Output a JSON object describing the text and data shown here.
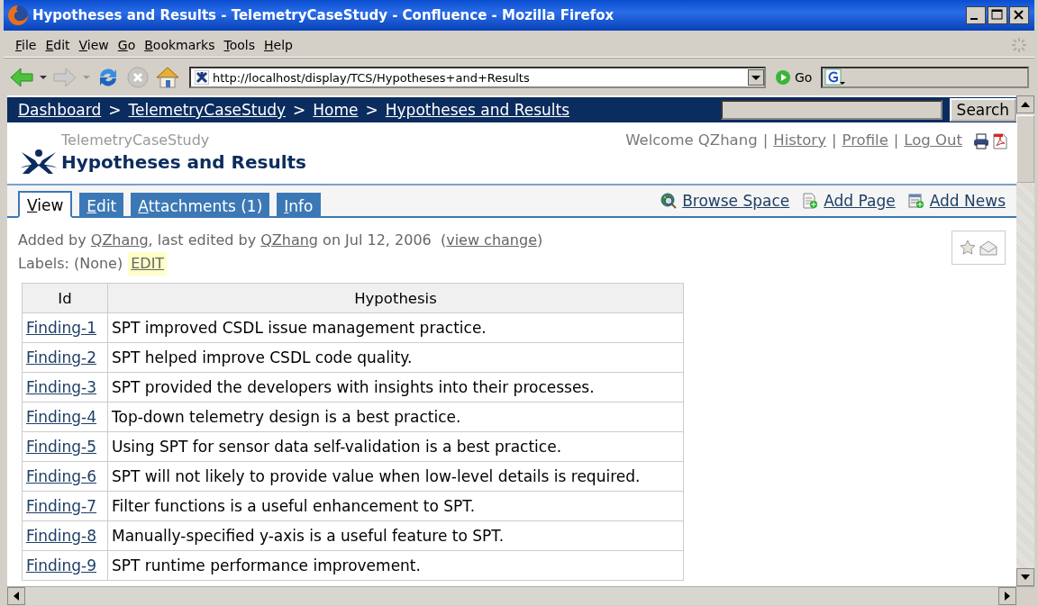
{
  "window": {
    "title": "Hypotheses and Results - TelemetryCaseStudy - Confluence - Mozilla Firefox"
  },
  "menu": [
    "File",
    "Edit",
    "View",
    "Go",
    "Bookmarks",
    "Tools",
    "Help"
  ],
  "address": {
    "url": "http://localhost/display/TCS/Hypotheses+and+Results",
    "go": "Go"
  },
  "breadcrumbs": {
    "separator": ">",
    "items": [
      "Dashboard",
      "TelemetryCaseStudy",
      "Home",
      "Hypotheses and Results"
    ]
  },
  "search": {
    "button": "Search"
  },
  "header": {
    "space": "TelemetryCaseStudy",
    "title": "Hypotheses and Results",
    "welcome": "Welcome QZhang",
    "separator": "|",
    "links": [
      "History",
      "Profile",
      "Log Out"
    ]
  },
  "tabs": [
    {
      "label": "View",
      "selected": true
    },
    {
      "label": "Edit",
      "selected": false
    },
    {
      "label": "Attachments (1)",
      "selected": false
    },
    {
      "label": "Info",
      "selected": false
    }
  ],
  "actions": [
    "Browse Space",
    "Add Page",
    "Add News"
  ],
  "meta": {
    "parts": [
      {
        "kind": "text",
        "text": "Added by "
      },
      {
        "kind": "link",
        "text": "QZhang"
      },
      {
        "kind": "text",
        "text": ", last edited by "
      },
      {
        "kind": "link",
        "text": "QZhang"
      },
      {
        "kind": "text",
        "text": " on Jul 12, 2006  ("
      },
      {
        "kind": "link",
        "text": "view change"
      },
      {
        "kind": "text",
        "text": ")"
      }
    ],
    "labels": "Labels: (None)",
    "labels_edit": "EDIT"
  },
  "table": {
    "columns": [
      "Id",
      "Hypothesis"
    ],
    "rows": [
      {
        "id": "Finding-1",
        "hypothesis": "SPT improved CSDL issue management practice."
      },
      {
        "id": "Finding-2",
        "hypothesis": "SPT helped improve CSDL code quality."
      },
      {
        "id": "Finding-3",
        "hypothesis": "SPT provided the developers with insights into their processes."
      },
      {
        "id": "Finding-4",
        "hypothesis": "Top-down telemetry design is a best practice."
      },
      {
        "id": "Finding-5",
        "hypothesis": "Using SPT for sensor data self-validation is a best practice."
      },
      {
        "id": "Finding-6",
        "hypothesis": "SPT will not likely to provide value when low-level details is required."
      },
      {
        "id": "Finding-7",
        "hypothesis": "Filter functions is a useful enhancement to SPT."
      },
      {
        "id": "Finding-8",
        "hypothesis": "Manually-specified y-axis is a useful feature to SPT."
      },
      {
        "id": "Finding-9",
        "hypothesis": "SPT runtime performance improvement."
      }
    ]
  }
}
